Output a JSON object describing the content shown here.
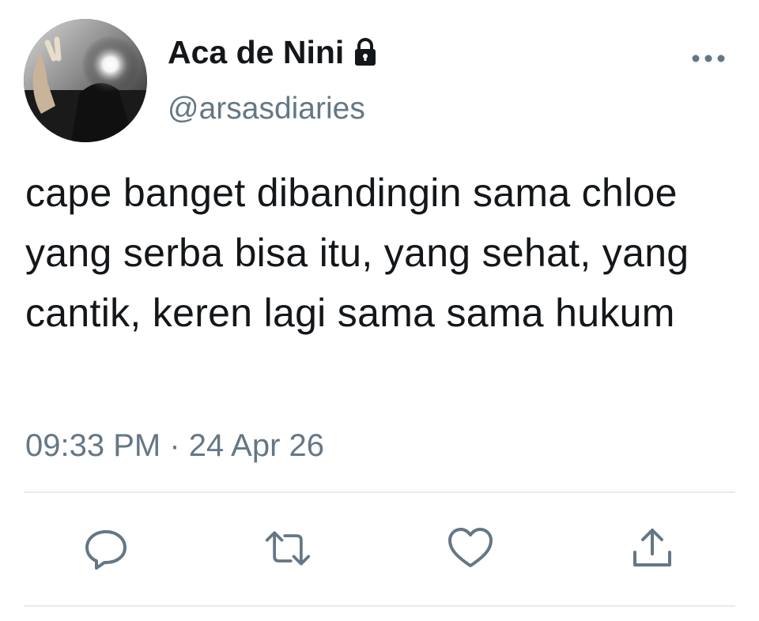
{
  "tweet": {
    "display_name": "Aca de Nini",
    "handle": "@arsasdiaries",
    "text": "cape banget dibandingin sama chloe yang serba bisa itu, yang sehat, yang cantik, keren lagi sama sama hukum",
    "timestamp": "09:33 PM · 24 Apr 26",
    "protected": true
  },
  "icons": {
    "lock": "lock-icon",
    "more": "more-dots-icon",
    "reply": "reply-icon",
    "retweet": "retweet-icon",
    "like": "heart-icon",
    "share": "share-icon"
  },
  "colors": {
    "text_primary": "#14171a",
    "text_secondary": "#657786",
    "icon_gray": "#657786",
    "divider": "#e6ecf0"
  }
}
